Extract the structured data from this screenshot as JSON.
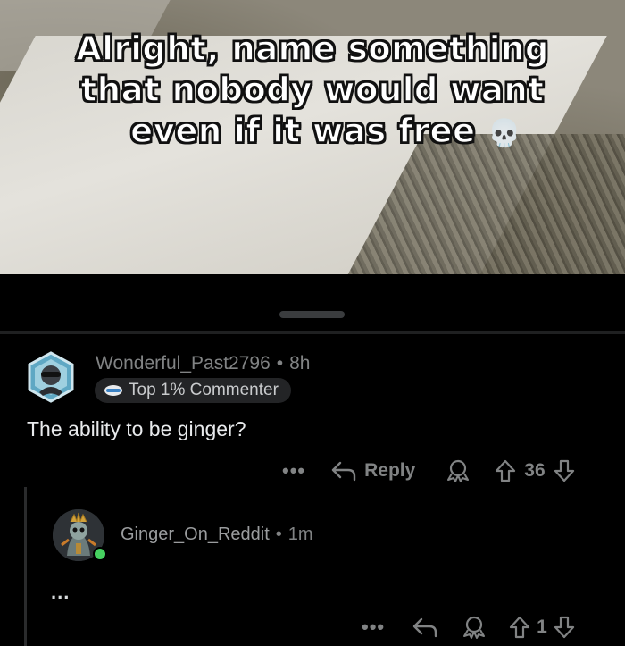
{
  "meme": {
    "caption_line1": "Alright, name something",
    "caption_line2": "that nobody would want",
    "caption_line3": "even if it was free",
    "emoji": "💀"
  },
  "comment1": {
    "username": "Wonderful_Past2796",
    "separator": "•",
    "age": "8h",
    "flair": "Top 1% Commenter",
    "body": "The ability to be ginger?",
    "more": "•••",
    "reply_label": "Reply",
    "score": "36"
  },
  "comment2": {
    "username": "Ginger_On_Reddit",
    "separator": "•",
    "age": "1m",
    "body": "...",
    "more": "•••",
    "score": "1",
    "online": true
  },
  "colors": {
    "background": "#000000",
    "meta_text": "#818384",
    "online_green": "#46d160"
  },
  "icons": [
    "skull-emoji",
    "reply-arrow-icon",
    "award-icon",
    "upvote-icon",
    "downvote-icon",
    "flair-badge-icon"
  ]
}
